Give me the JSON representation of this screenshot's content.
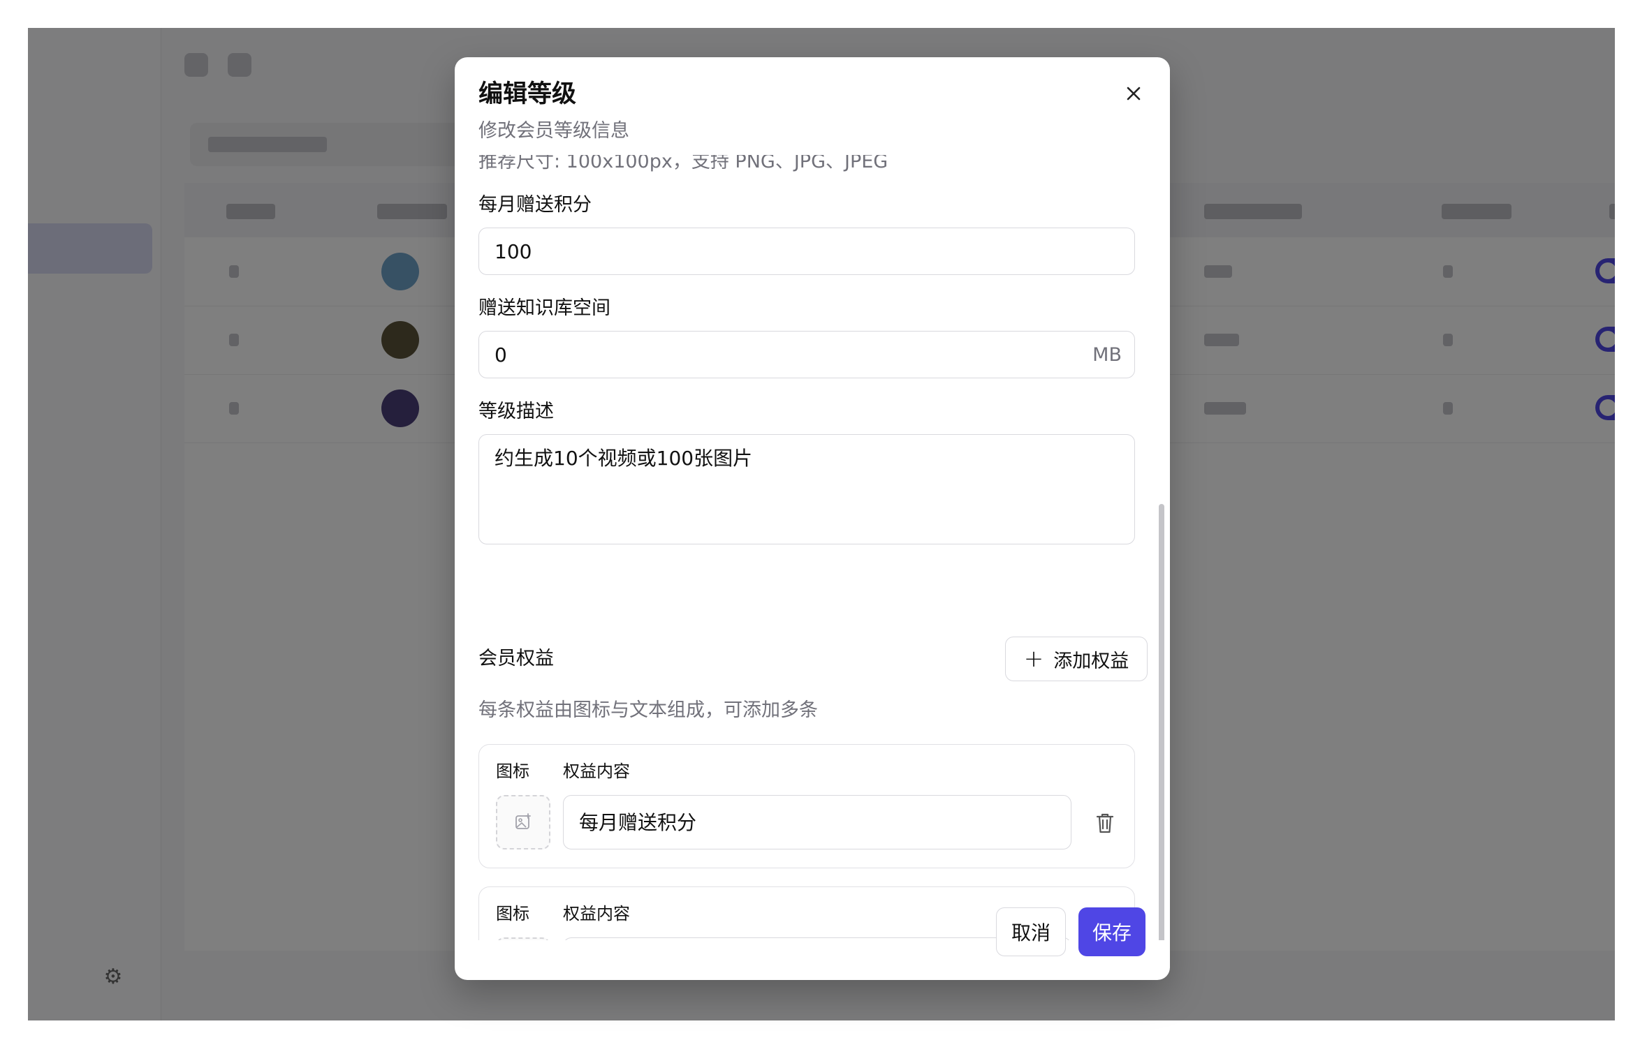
{
  "dialog": {
    "title": "编辑等级",
    "subtitle": "修改会员等级信息",
    "size_hint": "推荐尺寸: 100x100px，支持 PNG、JPG、JPEG",
    "monthly_points": {
      "label": "每月赠送积分",
      "value": "100"
    },
    "storage": {
      "label": "赠送知识库空间",
      "value": "0",
      "unit": "MB"
    },
    "description": {
      "label": "等级描述",
      "value": "约生成10个视频或100张图片"
    },
    "benefits": {
      "label": "会员权益",
      "add_label": "添加权益",
      "hint": "每条权益由图标与文本组成，可添加多条",
      "items": [
        {
          "icon_label": "图标",
          "content_label": "权益内容",
          "content": "每月赠送积分"
        },
        {
          "icon_label": "图标",
          "content_label": "权益内容",
          "content": ""
        }
      ]
    },
    "cancel_label": "取消",
    "save_label": "保存"
  },
  "colors": {
    "accent": "#4f46e5",
    "overlay": "rgba(0,0,0,0.5)",
    "muted_text": "#71717a",
    "border": "#d9d9de"
  },
  "icons": [
    "close-icon",
    "plus-icon",
    "image-add-icon",
    "trash-icon"
  ]
}
